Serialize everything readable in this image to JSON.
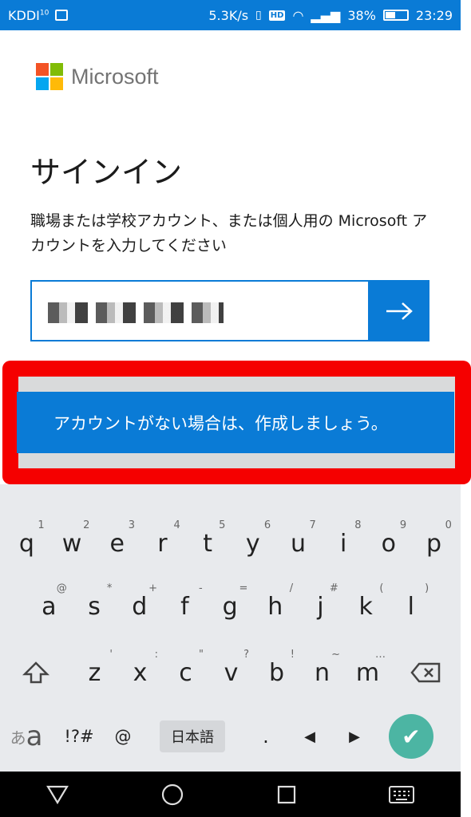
{
  "statusbar": {
    "carrier": "KDDI",
    "carrier_sup": "10",
    "net_speed": "5.3K/s",
    "hd": "HD",
    "battery": "38%",
    "time": "23:29"
  },
  "brand": {
    "name": "Microsoft",
    "colors": [
      "#f35325",
      "#81bc06",
      "#05a6f0",
      "#ffba08"
    ]
  },
  "page": {
    "title": "サインイン",
    "description": "職場または学校アカウント、または個人用の Microsoft アカウントを入力してください",
    "email_placeholder": "",
    "next_icon": "arrow-right-icon",
    "create_account": "アカウントがない場合は、作成しましょう。"
  },
  "keyboard": {
    "row1": [
      {
        "k": "q",
        "s": "1"
      },
      {
        "k": "w",
        "s": "2"
      },
      {
        "k": "e",
        "s": "3"
      },
      {
        "k": "r",
        "s": "4"
      },
      {
        "k": "t",
        "s": "5"
      },
      {
        "k": "y",
        "s": "6"
      },
      {
        "k": "u",
        "s": "7"
      },
      {
        "k": "i",
        "s": "8"
      },
      {
        "k": "o",
        "s": "9"
      },
      {
        "k": "p",
        "s": "0"
      }
    ],
    "row2": [
      {
        "k": "a",
        "s": "@"
      },
      {
        "k": "s",
        "s": "*"
      },
      {
        "k": "d",
        "s": "+"
      },
      {
        "k": "f",
        "s": "-"
      },
      {
        "k": "g",
        "s": "="
      },
      {
        "k": "h",
        "s": "/"
      },
      {
        "k": "j",
        "s": "#"
      },
      {
        "k": "k",
        "s": "("
      },
      {
        "k": "l",
        "s": ")"
      }
    ],
    "row3": [
      {
        "k": "z",
        "s": "'"
      },
      {
        "k": "x",
        "s": ":"
      },
      {
        "k": "c",
        "s": "\""
      },
      {
        "k": "v",
        "s": "?"
      },
      {
        "k": "b",
        "s": "!"
      },
      {
        "k": "n",
        "s": "~"
      },
      {
        "k": "m",
        "s": "…"
      }
    ],
    "row4": {
      "lang_small": "あ",
      "lang_big": "a",
      "symbols": "!?#",
      "at": "@",
      "ime": "日本語",
      "period": "."
    }
  },
  "colors": {
    "accent": "#0a7bd6",
    "highlight": "#f50000",
    "check": "#4cb5a3"
  }
}
